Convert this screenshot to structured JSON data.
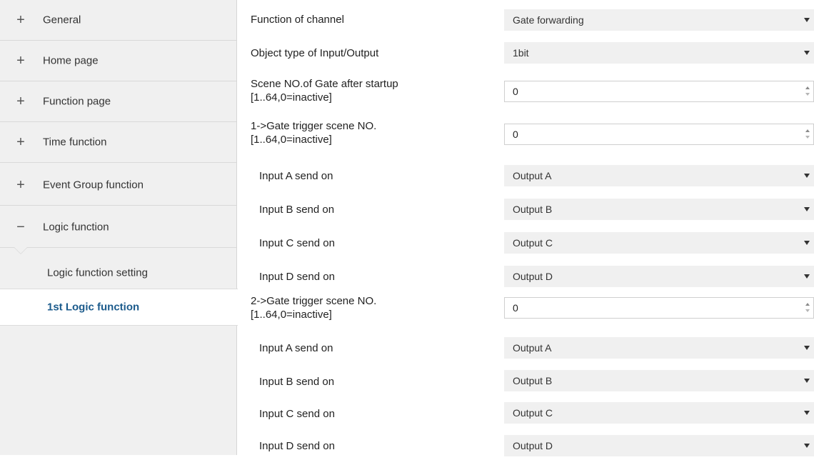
{
  "sidebar": {
    "groups": [
      {
        "sign": "+",
        "label": "General"
      },
      {
        "sign": "+",
        "label": "Home page"
      },
      {
        "sign": "+",
        "label": "Function page"
      },
      {
        "sign": "+",
        "label": "Time function"
      },
      {
        "sign": "+",
        "label": "Event Group function"
      },
      {
        "sign": "−",
        "label": "Logic function"
      }
    ],
    "sub_items": [
      {
        "label": "Logic function setting",
        "selected": false
      },
      {
        "label": "1st Logic function",
        "selected": true
      }
    ]
  },
  "params": [
    {
      "label": "Function of channel",
      "type": "select",
      "value": "Gate forwarding"
    },
    {
      "label": "Object type of Input/Output",
      "type": "select",
      "value": "1bit"
    },
    {
      "label_line1": "Scene NO.of  Gate after startup",
      "label_line2": "[1..64,0=inactive]",
      "type": "spin",
      "value": "0"
    },
    {
      "label_line1": "1->Gate trigger scene NO.",
      "label_line2": "[1..64,0=inactive]",
      "type": "spin",
      "value": "0"
    },
    {
      "label": "Input A send on",
      "type": "select",
      "value": "Output A"
    },
    {
      "label": "Input B send on",
      "type": "select",
      "value": "Output B"
    },
    {
      "label": "Input C send on",
      "type": "select",
      "value": "Output C"
    },
    {
      "label": "Input D send on",
      "type": "select",
      "value": "Output D"
    },
    {
      "label_line1": "2->Gate trigger scene NO.",
      "label_line2": "[1..64,0=inactive]",
      "type": "spin",
      "value": "0"
    },
    {
      "label": "Input A send on",
      "type": "select",
      "value": "Output A"
    },
    {
      "label": "Input B send on",
      "type": "select",
      "value": "Output B"
    },
    {
      "label": "Input C send on",
      "type": "select",
      "value": "Output C"
    },
    {
      "label": "Input D send on",
      "type": "select",
      "value": "Output D"
    }
  ],
  "icons": {
    "dropdown": "chevron-down-icon",
    "spin": "spinner-arrows-icon"
  }
}
